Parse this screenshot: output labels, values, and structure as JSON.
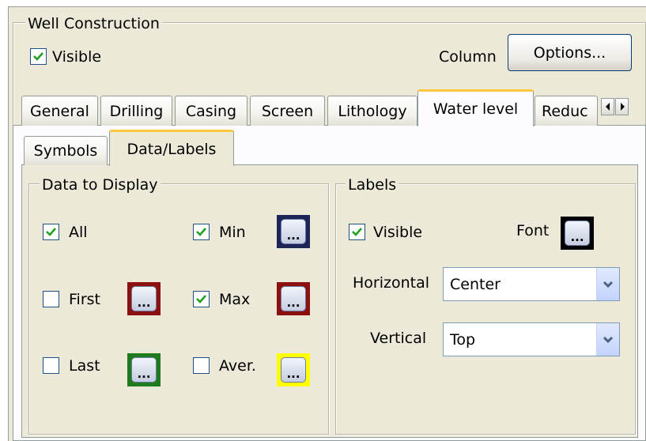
{
  "group_title": "Well Construction",
  "visible_checkbox": {
    "label": "Visible",
    "checked": true
  },
  "column_label": "Column",
  "options_button": "Options...",
  "main_tabs": [
    {
      "label": "General"
    },
    {
      "label": "Drilling"
    },
    {
      "label": "Casing"
    },
    {
      "label": "Screen"
    },
    {
      "label": "Lithology"
    },
    {
      "label": "Water level",
      "active": true
    },
    {
      "label": "Reduc"
    }
  ],
  "sub_tabs": [
    {
      "label": "Symbols"
    },
    {
      "label": "Data/Labels",
      "active": true
    }
  ],
  "data_to_display": {
    "title": "Data to Display",
    "items": [
      {
        "label": "All",
        "checked": true
      },
      {
        "label": "Min",
        "checked": true,
        "color": "#1c2458"
      },
      {
        "label": "First",
        "checked": false,
        "color": "#8b1010"
      },
      {
        "label": "Max",
        "checked": true,
        "color": "#8b1010"
      },
      {
        "label": "Last",
        "checked": false,
        "color": "#1d7a1d"
      },
      {
        "label": "Aver.",
        "checked": false,
        "color": "#ffff00"
      }
    ],
    "button_glyph": "..."
  },
  "labels": {
    "title": "Labels",
    "visible": {
      "label": "Visible",
      "checked": true
    },
    "font_label": "Font",
    "font_color": "#000000",
    "horizontal_label": "Horizontal",
    "horizontal_value": "Center",
    "vertical_label": "Vertical",
    "vertical_value": "Top"
  },
  "icons": {
    "check": "checkmark-icon",
    "left": "arrow-left-icon",
    "right": "arrow-right-icon",
    "dropdown": "chevron-down-icon"
  }
}
